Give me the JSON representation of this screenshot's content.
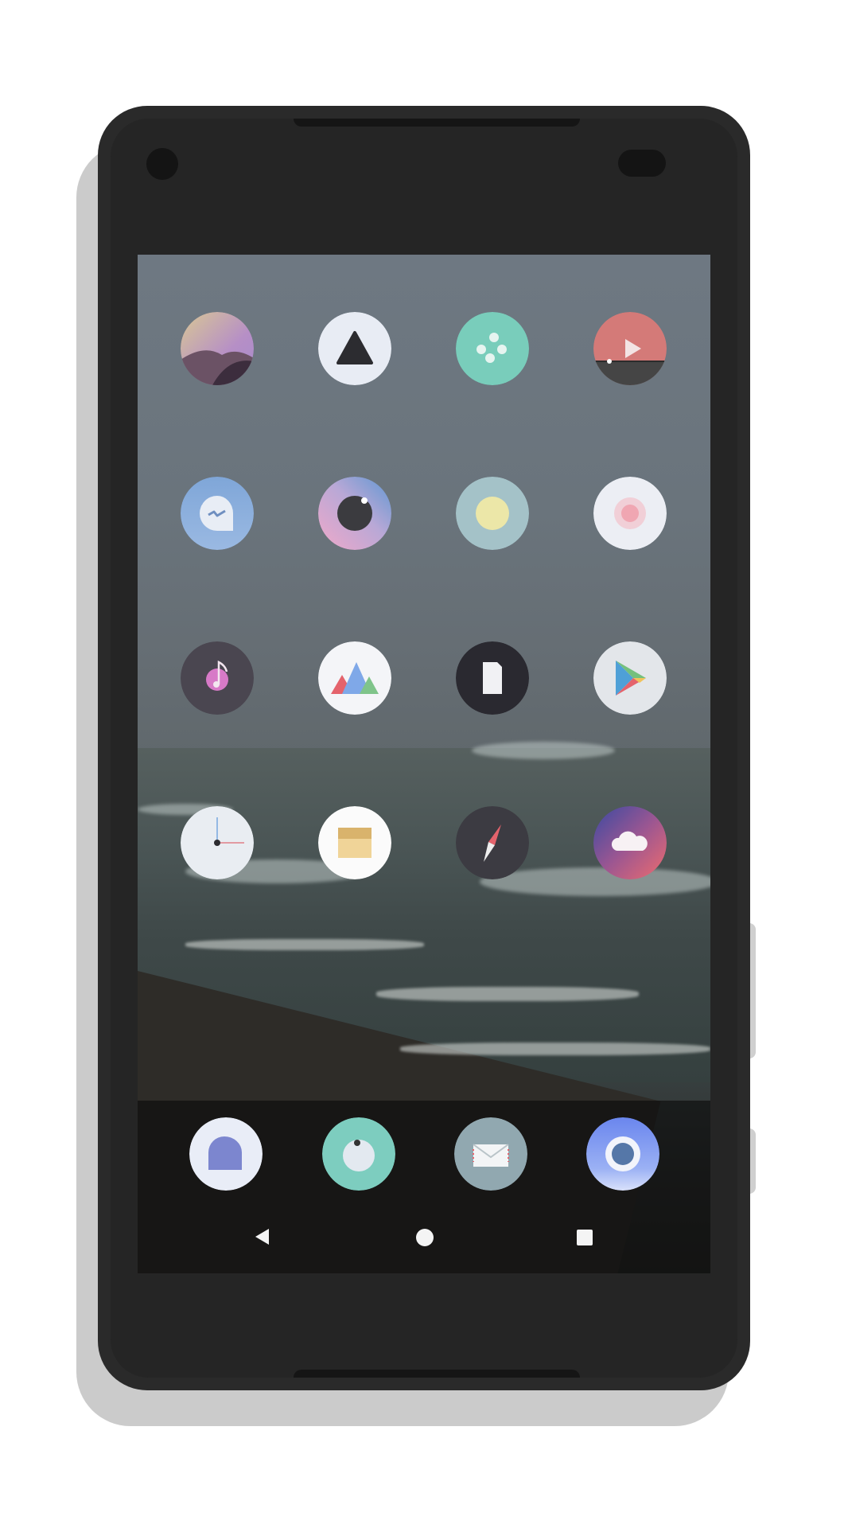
{
  "device": {
    "frame_color": "#2a2a2a",
    "shadow_color": "#cbcbcb",
    "screen_wallpaper": "foggy-beach"
  },
  "home_grid": {
    "icons": [
      {
        "name": "gallery-landscape-icon",
        "color": "#b58fc4"
      },
      {
        "name": "triangle-launcher-icon",
        "color": "#e8ecf4"
      },
      {
        "name": "dots-game-icon",
        "color": "#79cdbb"
      },
      {
        "name": "video-player-icon",
        "color": "#d47a78"
      },
      {
        "name": "messenger-bubble-icon",
        "color": "#8fb1dc"
      },
      {
        "name": "camera-lens-icon",
        "color": "#d8a0c8"
      },
      {
        "name": "weather-sun-icon",
        "color": "#a4c2c8"
      },
      {
        "name": "record-button-icon",
        "color": "#eceef4"
      },
      {
        "name": "music-note-icon",
        "color": "#4a4650"
      },
      {
        "name": "mountains-photos-icon",
        "color": "#f4f5f8"
      },
      {
        "name": "files-document-icon",
        "color": "#2a2930"
      },
      {
        "name": "play-store-icon",
        "color": "#e3e6ea"
      },
      {
        "name": "clock-icon",
        "color": "#e9edf2"
      },
      {
        "name": "notes-box-icon",
        "color": "#fbfbfb"
      },
      {
        "name": "compass-icon",
        "color": "#3c3b42"
      },
      {
        "name": "cloud-weather-icon",
        "color": "#d86575"
      }
    ]
  },
  "dock": {
    "icons": [
      {
        "name": "chat-bubble-icon",
        "color": "#e9edf7"
      },
      {
        "name": "camera-app-icon",
        "color": "#7dcdbf"
      },
      {
        "name": "mail-envelope-icon",
        "color": "#91a8b0"
      },
      {
        "name": "browser-circle-icon",
        "color": "#6f90f0"
      }
    ]
  },
  "navigation": {
    "buttons": [
      "back-icon",
      "home-icon",
      "recents-icon"
    ]
  }
}
